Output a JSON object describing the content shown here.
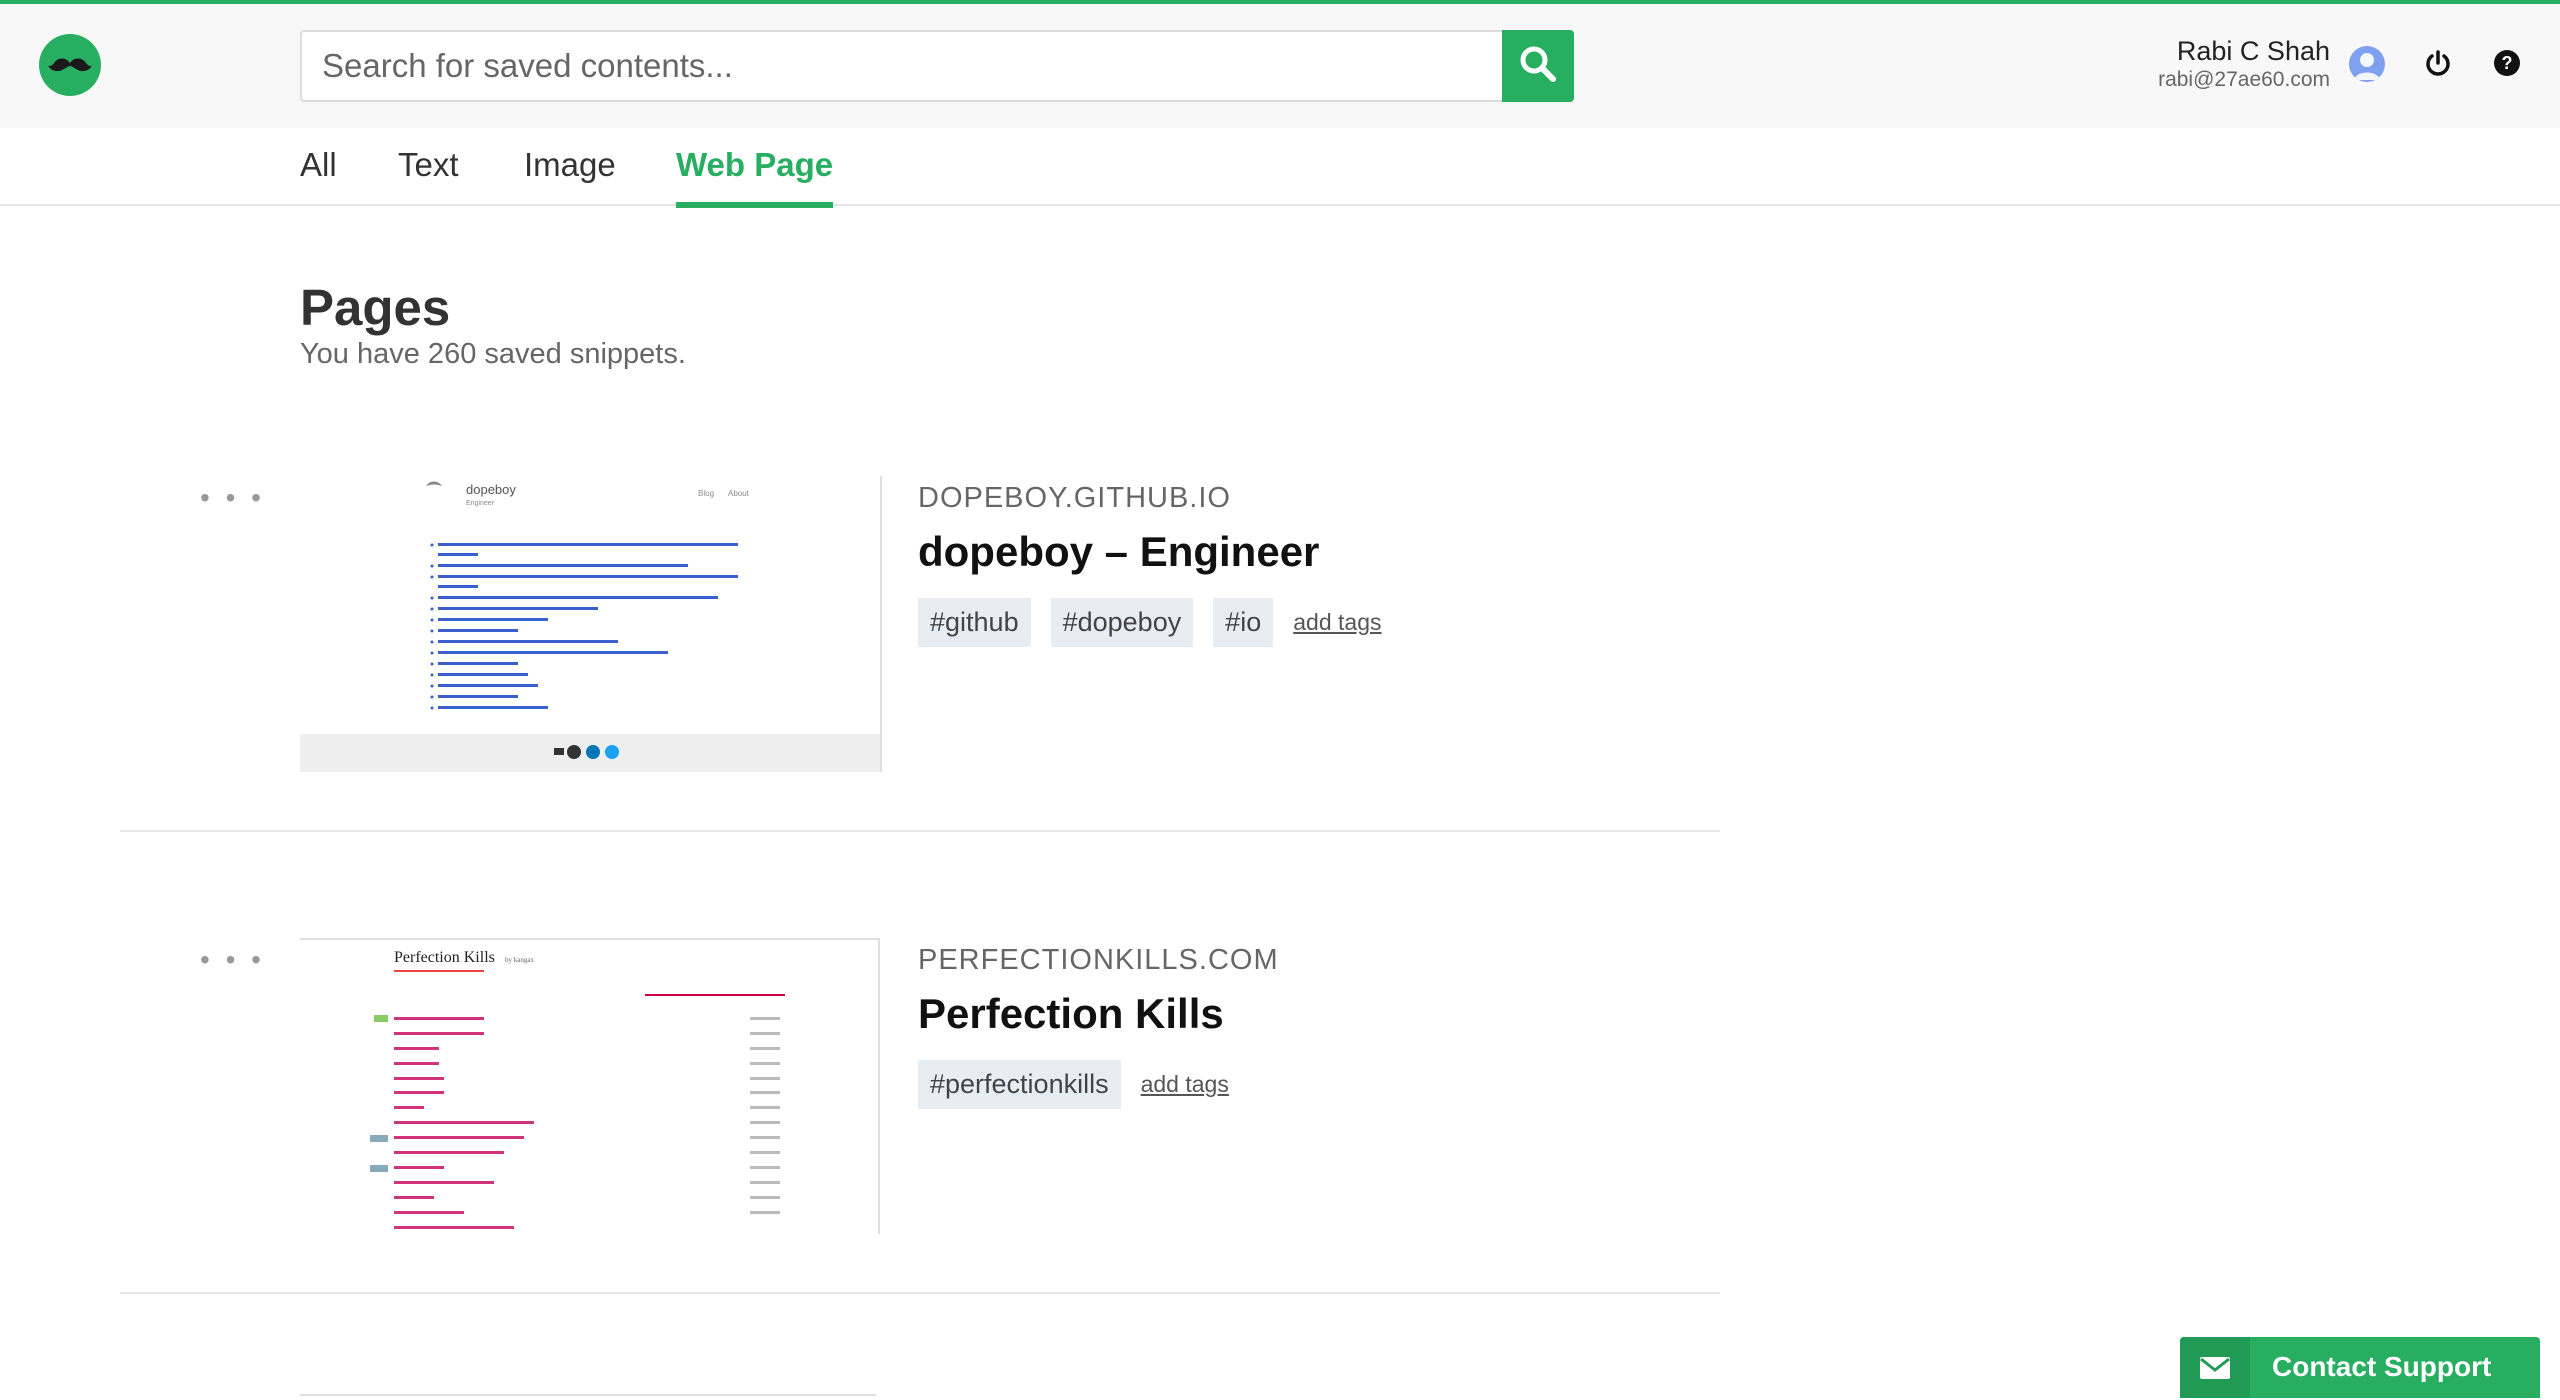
{
  "header": {
    "search_placeholder": "Search for saved contents...",
    "user_name": "Rabi C Shah",
    "user_email": "rabi@27ae60.com"
  },
  "tabs": [
    {
      "label": "All",
      "active": false
    },
    {
      "label": "Text",
      "active": false
    },
    {
      "label": "Image",
      "active": false
    },
    {
      "label": "Web Page",
      "active": true
    }
  ],
  "page": {
    "title": "Pages",
    "subtitle": "You have 260 saved snippets."
  },
  "items": [
    {
      "domain": "DOPEBOY.GITHUB.IO",
      "title": "dopeboy – Engineer",
      "tags": [
        "#github",
        "#dopeboy",
        "#io"
      ],
      "add_tags": "add tags",
      "thumbnail": {
        "site_name": "dopeboy",
        "site_sub": "Engineer",
        "nav": [
          "Blog",
          "About"
        ]
      }
    },
    {
      "domain": "PERFECTIONKILLS.COM",
      "title": "Perfection Kills",
      "tags": [
        "#perfectionkills"
      ],
      "add_tags": "add tags",
      "thumbnail": {
        "site_name": "Perfection Kills",
        "site_sub": "by kangax"
      }
    }
  ],
  "support": {
    "label": "Contact Support"
  },
  "colors": {
    "accent": "#27ae60",
    "tag_bg": "#e6edf3"
  },
  "icons": [
    "mustache-logo-icon",
    "search-icon",
    "avatar-icon",
    "power-icon",
    "help-icon",
    "mail-icon",
    "more-dots-icon"
  ]
}
